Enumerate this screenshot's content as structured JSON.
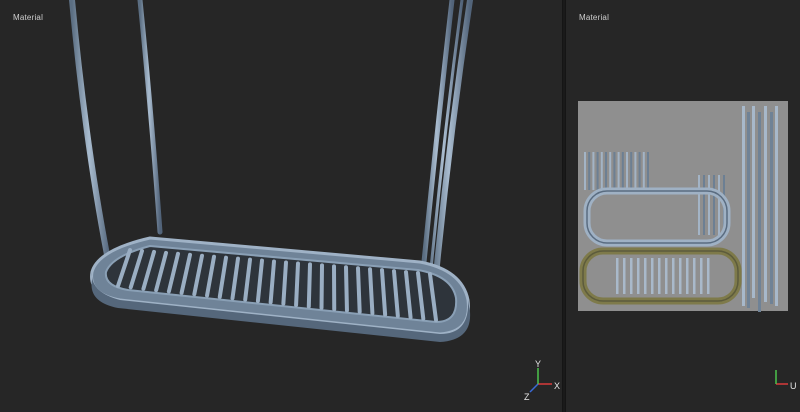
{
  "viewports": {
    "perspective": {
      "title": "Material"
    },
    "uv": {
      "title": "Material"
    }
  },
  "gizmo3d": {
    "x_label": "X",
    "y_label": "Y",
    "z_label": "Z"
  },
  "gizmo_uv": {
    "u_label": "U"
  },
  "colors": {
    "background": "#262626",
    "metal": "#8ea2b8",
    "uv_sheet": "#8f8f8f",
    "axis_x": "#d83a3a",
    "axis_y": "#4cc34c",
    "axis_z": "#3a6ad8"
  }
}
